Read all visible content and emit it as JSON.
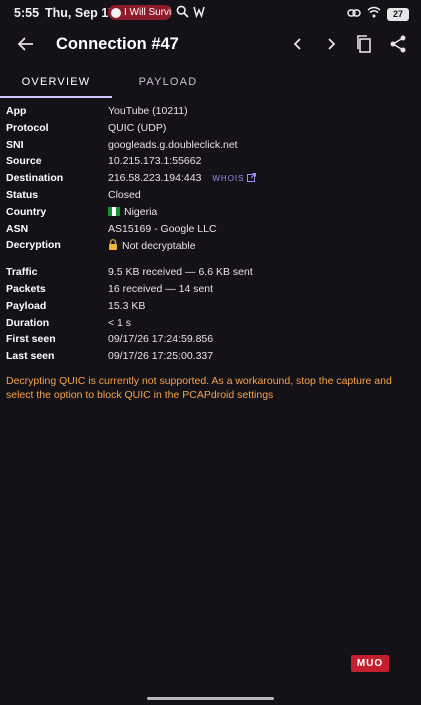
{
  "status_bar": {
    "time": "5:55",
    "date": "Thu, Sep 17",
    "media_chip": "I Will Survi",
    "battery": "27"
  },
  "app_bar": {
    "title": "Connection #47"
  },
  "tabs": [
    "OVERVIEW",
    "PAYLOAD"
  ],
  "details": {
    "connection": [
      {
        "label": "App",
        "value": "YouTube (10211)"
      },
      {
        "label": "Protocol",
        "value": "QUIC (UDP)"
      },
      {
        "label": "SNI",
        "value": "googleads.g.doubleclick.net"
      },
      {
        "label": "Source",
        "value": "10.215.173.1:55662"
      },
      {
        "label": "Destination",
        "value": "216.58.223.194:443"
      },
      {
        "label": "Status",
        "value": "Closed"
      },
      {
        "label": "Country",
        "value": "Nigeria"
      },
      {
        "label": "ASN",
        "value": "AS15169 - Google LLC"
      },
      {
        "label": "Decryption",
        "value": "Not decryptable"
      }
    ],
    "whois": "WHOIS",
    "stats": [
      {
        "label": "Traffic",
        "value": "9.5 KB received — 6.6 KB sent"
      },
      {
        "label": "Packets",
        "value": "16 received — 14 sent"
      },
      {
        "label": "Payload",
        "value": "15.3 KB"
      },
      {
        "label": "Duration",
        "value": "< 1 s"
      },
      {
        "label": "First seen",
        "value": "09/17/26 17:24:59.856"
      },
      {
        "label": "Last seen",
        "value": "09/17/26 17:25:00.337"
      }
    ]
  },
  "warning": "Decrypting QUIC is currently not supported. As a workaround, stop the capture and select the option to block QUIC in the PCAPdroid settings",
  "watermark": "MUO",
  "colors": {
    "background": "#141218",
    "accent": "#cfc8ff",
    "whois": "#9c8ff0",
    "warning": "#f4a24a"
  }
}
